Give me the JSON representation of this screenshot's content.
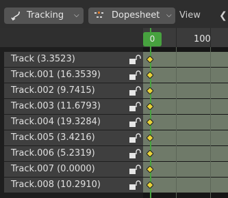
{
  "header": {
    "editor_type": {
      "label": "Tracking",
      "icon": "tracking-icon"
    },
    "mode": {
      "label": "Dopesheet",
      "icon": "dopesheet-icon"
    },
    "view_label": "View",
    "back_icon": "arrow-left-icon"
  },
  "ruler": {
    "current_frame": "0",
    "label_100": "100"
  },
  "tracks": [
    {
      "name": "Track (3.3523)"
    },
    {
      "name": "Track.001 (16.3539)"
    },
    {
      "name": "Track.002 (9.7415)"
    },
    {
      "name": "Track.003 (11.6793)"
    },
    {
      "name": "Track.004 (19.3284)"
    },
    {
      "name": "Track.005 (3.4216)"
    },
    {
      "name": "Track.006 (5.2319)"
    },
    {
      "name": "Track.007 (0.0000)"
    },
    {
      "name": "Track.008 (10.2910)"
    }
  ],
  "colors": {
    "playhead": "#47a23f",
    "keyframe": "#e8d23a",
    "channel_bg": "#6f7a69"
  }
}
